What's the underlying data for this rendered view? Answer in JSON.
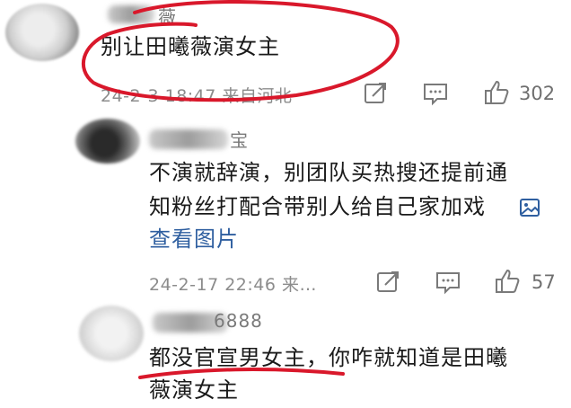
{
  "colors": {
    "annotation_red": "#d9182b",
    "link_blue": "#2f5fa0",
    "meta_gray": "#8c8c8c"
  },
  "comments": [
    {
      "username": "薇",
      "text": "别让田曦薇演女主",
      "meta": "24-2-3 18:47 来自河北",
      "likes": "302"
    },
    {
      "username": "宝",
      "text_line1": "不演就辞演，别团队买热搜还提前通",
      "text_line2": "知粉丝打配合带别人给自己家加戏",
      "view_image": "查看图片",
      "meta": "24-2-17 22:46 来…",
      "likes": "57"
    },
    {
      "username": "6888",
      "text_line1": "都没官宣男女主，你咋就知道是田曦",
      "text_line2": "薇演女主"
    }
  ],
  "icons": {
    "share": "share-icon",
    "comment": "comment-icon",
    "like": "thumbs-up-icon",
    "image": "image-icon"
  }
}
